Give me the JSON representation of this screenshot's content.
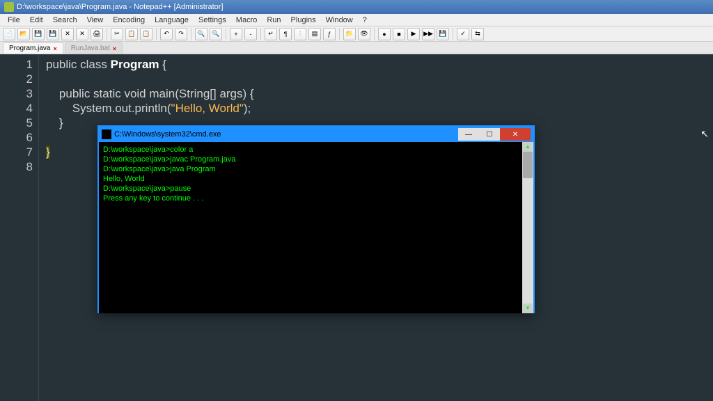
{
  "window": {
    "title": "D:\\workspace\\java\\Program.java - Notepad++ [Administrator]"
  },
  "menu": [
    "File",
    "Edit",
    "Search",
    "View",
    "Encoding",
    "Language",
    "Settings",
    "Macro",
    "Run",
    "Plugins",
    "Window",
    "?"
  ],
  "tabs": [
    {
      "label": "Program.java",
      "active": true
    },
    {
      "label": "RunJava.bat",
      "active": false
    }
  ],
  "code": {
    "lines": [
      "1",
      "2",
      "3",
      "4",
      "5",
      "6",
      "7",
      "8"
    ],
    "l1_public": "public ",
    "l1_class": "class ",
    "l1_name": "Program ",
    "l1_brace": "{",
    "l3_indent": "    ",
    "l3_kw": "public static void ",
    "l3_sig": "main(String[] args) {",
    "l4_indent": "        ",
    "l4_call": "System.out.println(",
    "l4_str": "\"Hello, World\"",
    "l4_end": ");",
    "l5_indent": "    ",
    "l5_brace": "}",
    "l7_brace": "}"
  },
  "cmd": {
    "title": "C:\\Windows\\system32\\cmd.exe",
    "lines": [
      "D:\\workspace\\java>color a",
      "",
      "D:\\workspace\\java>javac Program.java",
      "",
      "D:\\workspace\\java>java Program",
      "Hello, World",
      "",
      "D:\\workspace\\java>pause",
      "Press any key to continue . . ."
    ]
  }
}
